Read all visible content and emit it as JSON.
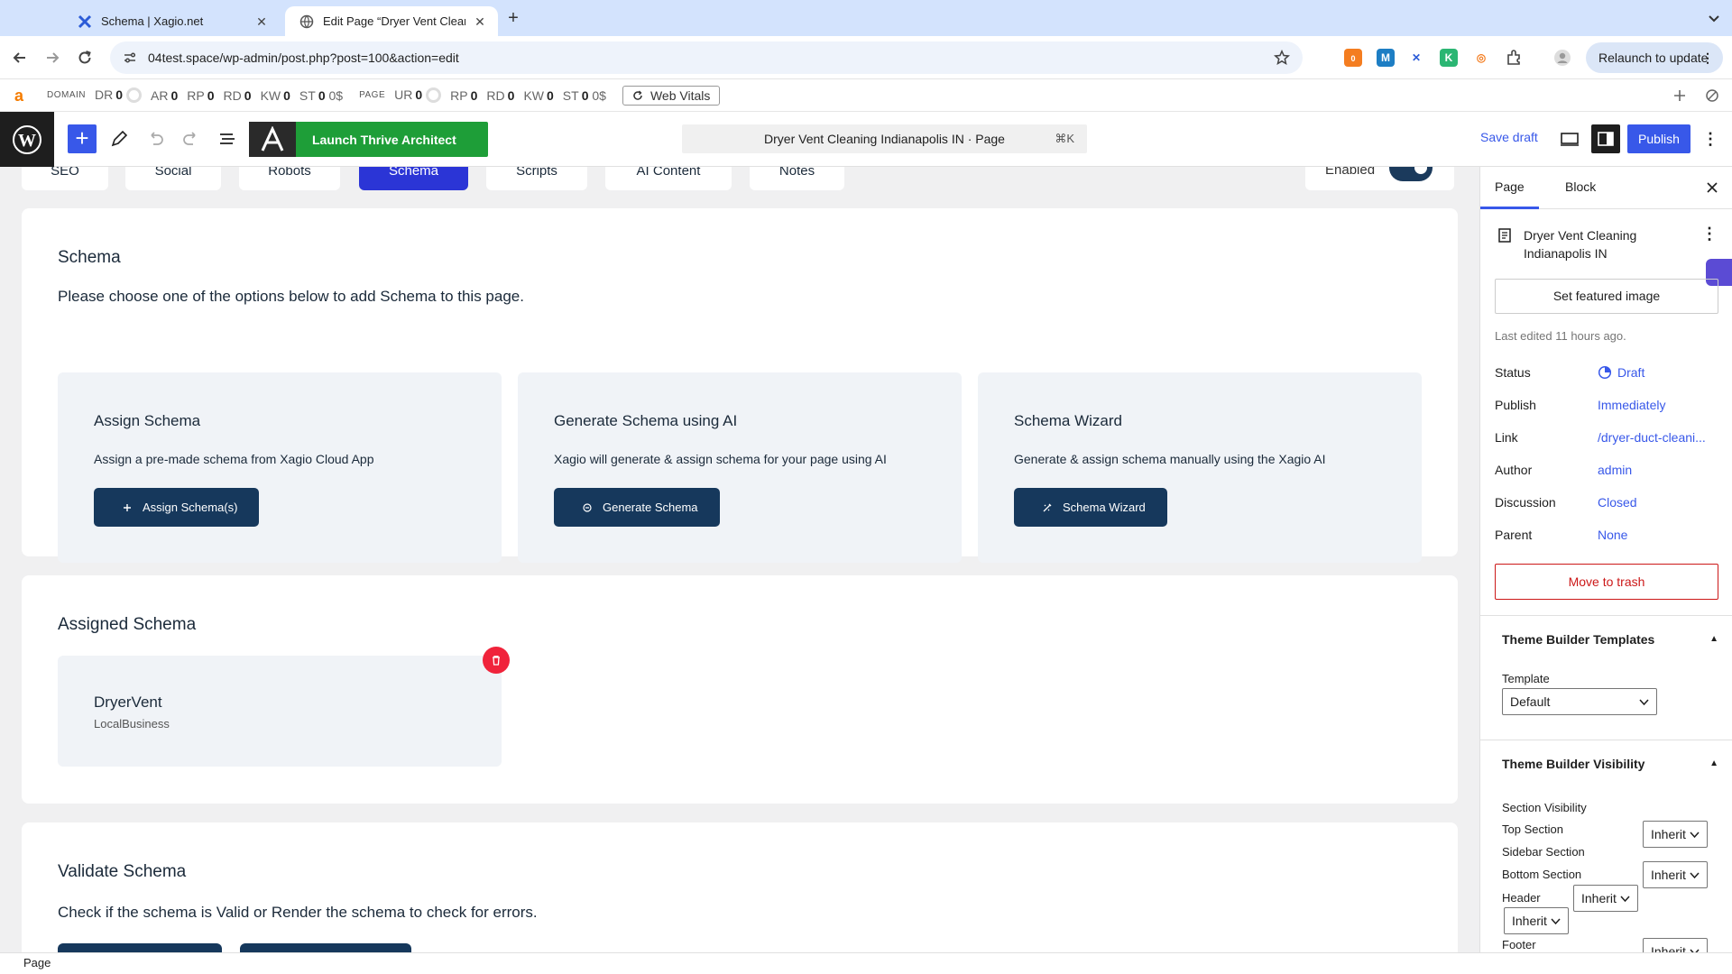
{
  "browser": {
    "tabs": [
      {
        "title": "Schema | Xagio.net",
        "active": false,
        "icon": "xagio-x-icon"
      },
      {
        "title": "Edit Page “Dryer Vent Cleanin",
        "active": true,
        "icon": "globe-icon"
      }
    ],
    "url": "04test.space/wp-admin/post.php?post=100&action=edit",
    "relaunch_label": "Relaunch to update",
    "extension_badge": "0"
  },
  "seobar": {
    "domain_label": "DOMAIN",
    "domain_metrics": [
      {
        "k": "DR",
        "v": "0"
      },
      {
        "k": "AR",
        "v": "0"
      },
      {
        "k": "RP",
        "v": "0"
      },
      {
        "k": "RD",
        "v": "0"
      },
      {
        "k": "KW",
        "v": "0"
      },
      {
        "k": "ST",
        "v": "0"
      }
    ],
    "domain_st_suffix": "0$",
    "page_label": "PAGE",
    "page_metrics": [
      {
        "k": "UR",
        "v": "0"
      },
      {
        "k": "RP",
        "v": "0"
      },
      {
        "k": "RD",
        "v": "0"
      },
      {
        "k": "KW",
        "v": "0"
      },
      {
        "k": "ST",
        "v": "0"
      }
    ],
    "page_st_suffix": "0$",
    "web_vitals_label": "Web Vitals"
  },
  "editor": {
    "thrive_label": "Launch Thrive Architect",
    "command_title": "Dryer Vent Cleaning Indianapolis IN · Page",
    "command_shortcut": "⌘K",
    "save_draft_label": "Save draft",
    "publish_label": "Publish"
  },
  "xagio_tabs": [
    "SEO",
    "Social",
    "Robots",
    "Schema",
    "Scripts",
    "AI Content",
    "Notes"
  ],
  "enabled_label": "Enabled",
  "schema_card": {
    "title": "Schema",
    "subtitle": "Please choose one of the options below to add Schema to this page.",
    "options": [
      {
        "title": "Assign Schema",
        "desc": "Assign a pre-made schema from Xagio Cloud App",
        "button": "Assign Schema(s)",
        "icon": "plus-icon"
      },
      {
        "title": "Generate Schema using AI",
        "desc": "Xagio will generate & assign schema for your page using AI",
        "button": "Generate Schema",
        "icon": "ai-icon"
      },
      {
        "title": "Schema Wizard",
        "desc": "Generate & assign schema manually using the Xagio AI",
        "button": "Schema Wizard",
        "icon": "wand-icon"
      }
    ]
  },
  "assigned_card": {
    "title": "Assigned Schema",
    "item_name": "DryerVent",
    "item_type": "LocalBusiness"
  },
  "validate_card": {
    "title": "Validate Schema",
    "subtitle": "Check if the schema is Valid or Render the schema to check for errors."
  },
  "sidebar": {
    "tab_page": "Page",
    "tab_block": "Block",
    "doc_title": "Dryer Vent Cleaning Indianapolis IN",
    "featured_label": "Set featured image",
    "last_edited": "Last edited 11 hours ago.",
    "props": [
      {
        "k": "Status",
        "v": "Draft"
      },
      {
        "k": "Publish",
        "v": "Immediately"
      },
      {
        "k": "Link",
        "v": "/dryer-duct-cleani..."
      },
      {
        "k": "Author",
        "v": "admin"
      },
      {
        "k": "Discussion",
        "v": "Closed"
      },
      {
        "k": "Parent",
        "v": "None"
      }
    ],
    "trash_label": "Move to trash",
    "tb_templates_title": "Theme Builder Templates",
    "template_label": "Template",
    "template_value": "Default",
    "tb_visibility_title": "Theme Builder Visibility",
    "section_visibility_label": "Section Visibility",
    "visibility_rows": [
      "Top Section",
      "Sidebar Section",
      "Bottom Section",
      "Header",
      "Footer"
    ],
    "inherit_label": "Inherit"
  },
  "status_bar": "Page"
}
